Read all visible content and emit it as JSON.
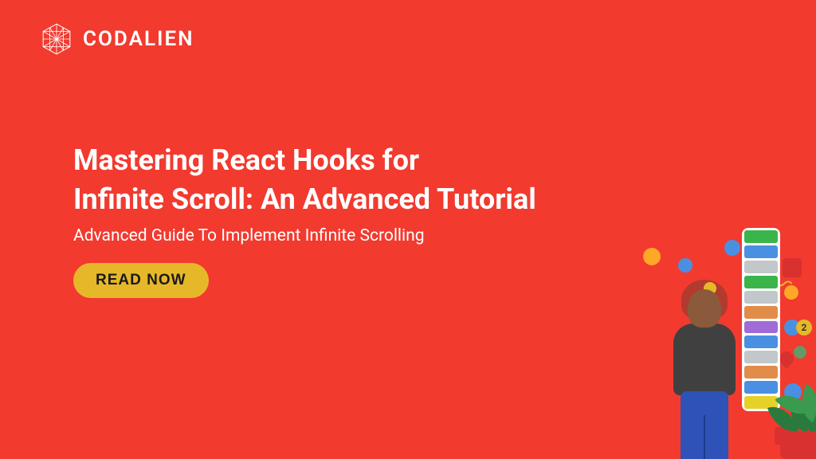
{
  "brand": {
    "name": "CODALIEN"
  },
  "hero": {
    "title_line1": "Mastering React Hooks for",
    "title_line2": "Infinite Scroll: An Advanced Tutorial",
    "subtitle": "Advanced Guide To Implement Infinite Scrolling",
    "cta_label": "READ NOW"
  },
  "badges": {
    "notification_count": "2"
  }
}
